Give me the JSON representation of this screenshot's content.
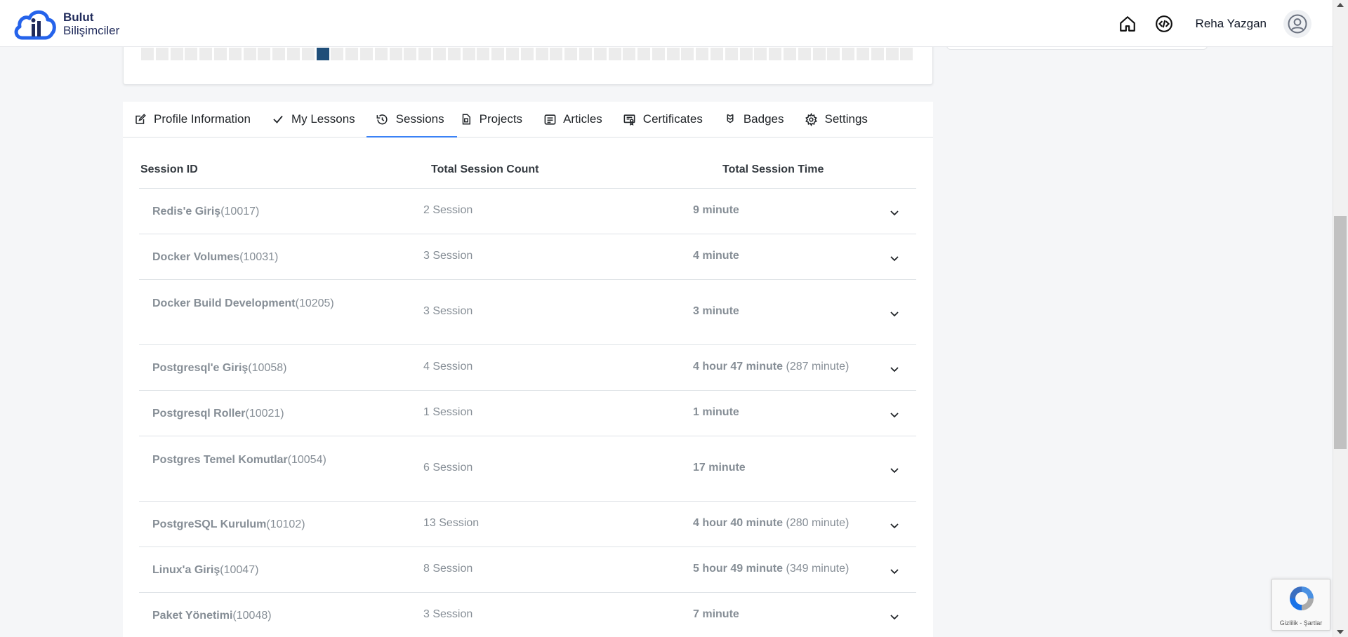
{
  "header": {
    "logo_line1": "Bulut",
    "logo_line2": "Bilişimciler",
    "user_name": "Reha Yazgan"
  },
  "activity": {
    "cell_count": 53,
    "active_index": 12,
    "active_color": "#1f4e79"
  },
  "tabs": [
    {
      "label": "Profile Information",
      "icon": "edit-icon"
    },
    {
      "label": "My Lessons",
      "icon": "check-icon"
    },
    {
      "label": "Sessions",
      "icon": "history-icon",
      "active": true
    },
    {
      "label": "Projects",
      "icon": "project-icon"
    },
    {
      "label": "Articles",
      "icon": "article-icon"
    },
    {
      "label": "Certificates",
      "icon": "certificate-icon"
    },
    {
      "label": "Badges",
      "icon": "badge-icon"
    },
    {
      "label": "Settings",
      "icon": "gear-icon"
    }
  ],
  "table": {
    "headers": {
      "id": "Session ID",
      "count": "Total Session Count",
      "time": "Total Session Time"
    },
    "rows": [
      {
        "name": "Redis'e Giriş",
        "id": "(10017)",
        "count": "2 Session",
        "time": "9 minute",
        "time_extra": ""
      },
      {
        "name": "Docker Volumes",
        "id": "(10031)",
        "count": "3 Session",
        "time": "4 minute",
        "time_extra": ""
      },
      {
        "name": "Docker Build Development",
        "id": "(10205)",
        "count": "3 Session",
        "time": "3 minute",
        "time_extra": ""
      },
      {
        "name": "Postgresql'e Giriş",
        "id": "(10058)",
        "count": "4 Session",
        "time": "4 hour 47 minute",
        "time_extra": "(287 minute)"
      },
      {
        "name": "Postgresql Roller",
        "id": "(10021)",
        "count": "1 Session",
        "time": "1 minute",
        "time_extra": ""
      },
      {
        "name": "Postgres Temel Komutlar",
        "id": "(10054)",
        "count": "6 Session",
        "time": "17 minute",
        "time_extra": ""
      },
      {
        "name": "PostgreSQL Kurulum",
        "id": "(10102)",
        "count": "13 Session",
        "time": "4 hour 40 minute",
        "time_extra": "(280 minute)"
      },
      {
        "name": "Linux'a Giriş",
        "id": "(10047)",
        "count": "8 Session",
        "time": "5 hour 49 minute",
        "time_extra": "(349 minute)"
      },
      {
        "name": "Paket Yönetimi",
        "id": "(10048)",
        "count": "3 Session",
        "time": "7 minute",
        "time_extra": ""
      }
    ]
  },
  "recaptcha": {
    "text": "Gizlilik - Şartlar"
  }
}
